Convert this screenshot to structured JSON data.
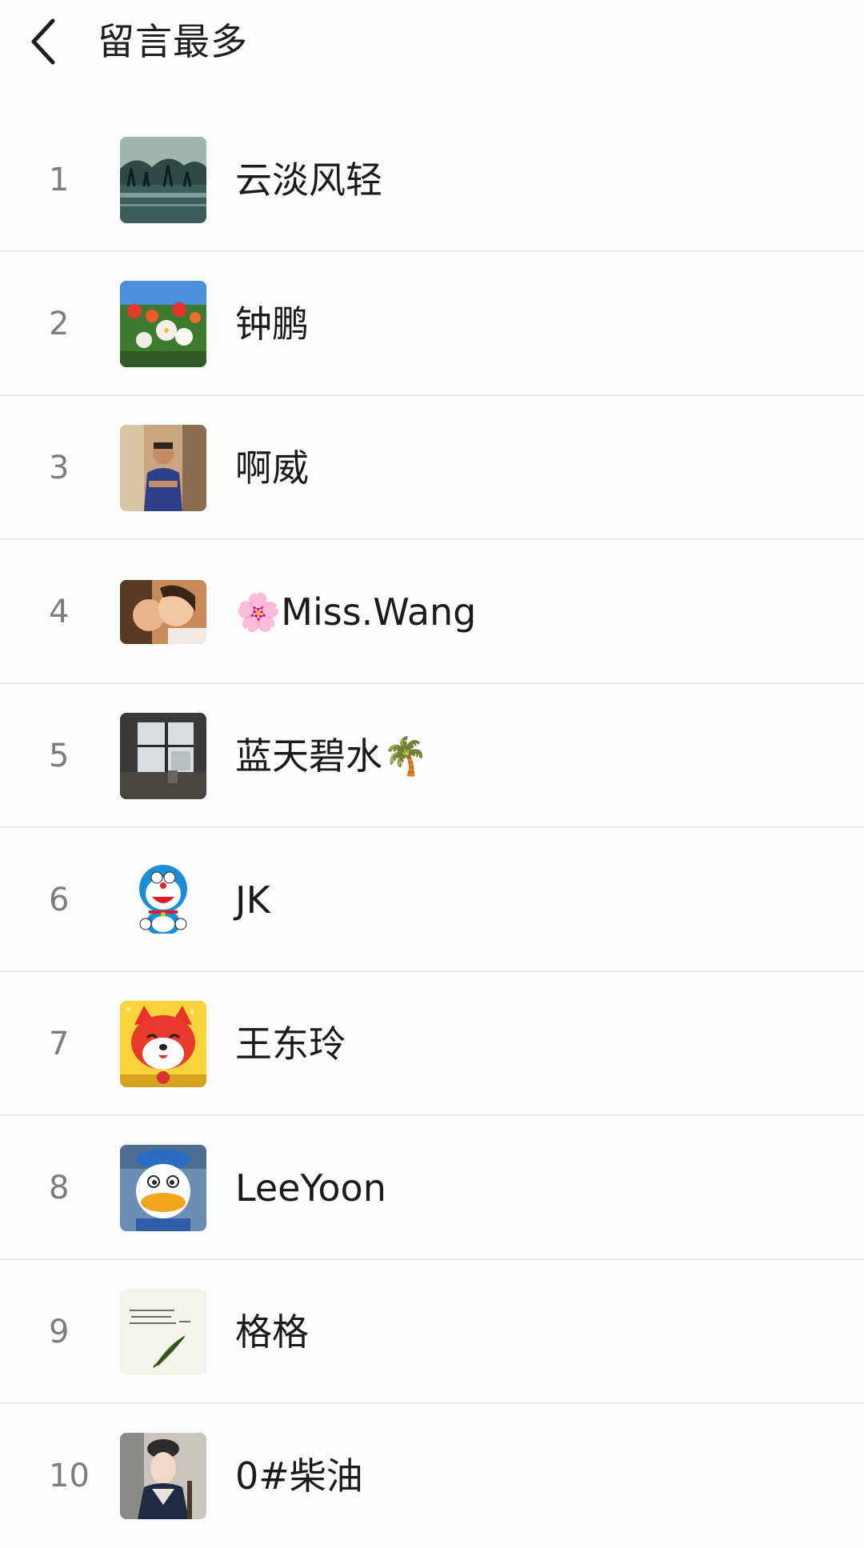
{
  "header": {
    "title": "留言最多",
    "back_icon": "chevron-left-icon"
  },
  "ranking": [
    {
      "rank": "1",
      "name": "云淡风轻",
      "avatar": "landscape-trees-avatar"
    },
    {
      "rank": "2",
      "name": "钟鹏",
      "avatar": "flowers-avatar"
    },
    {
      "rank": "3",
      "name": "啊威",
      "avatar": "man-photo-avatar"
    },
    {
      "rank": "4",
      "name": "🌸Miss.Wang",
      "avatar": "mother-child-avatar"
    },
    {
      "rank": "5",
      "name": "蓝天碧水🌴",
      "avatar": "window-view-avatar"
    },
    {
      "rank": "6",
      "name": "JK",
      "avatar": "doraemon-avatar"
    },
    {
      "rank": "7",
      "name": "王东玲",
      "avatar": "red-fox-cartoon-avatar"
    },
    {
      "rank": "8",
      "name": "LeeYoon",
      "avatar": "donald-duck-avatar"
    },
    {
      "rank": "9",
      "name": "格格",
      "avatar": "feather-calligraphy-avatar"
    },
    {
      "rank": "10",
      "name": "0#柴油",
      "avatar": "traditional-costume-avatar"
    }
  ]
}
